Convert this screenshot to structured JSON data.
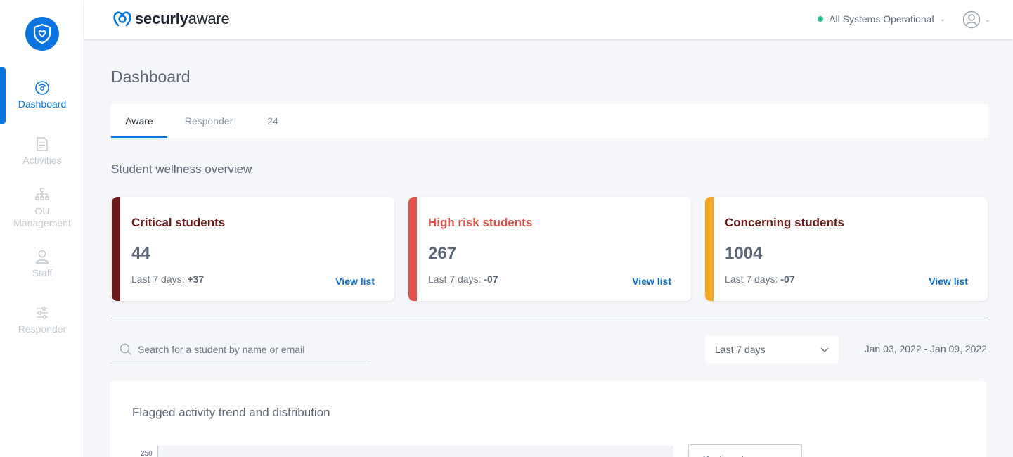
{
  "brand": {
    "name_part1": "securly",
    "name_part2": "aware"
  },
  "sidebar": {
    "items": [
      {
        "label": "Dashboard",
        "icon": "dashboard-gauge-icon",
        "active": true
      },
      {
        "label": "Activities",
        "icon": "document-icon",
        "active": false
      },
      {
        "label": "OU Management",
        "icon": "org-tree-icon",
        "active": false
      },
      {
        "label": "Staff",
        "icon": "person-icon",
        "active": false
      },
      {
        "label": "Responder",
        "icon": "sliders-icon",
        "active": false
      }
    ]
  },
  "header": {
    "status_text": "All Systems Operational",
    "status_color": "#27c08f"
  },
  "page": {
    "title": "Dashboard",
    "tabs": [
      {
        "label": "Aware",
        "active": true
      },
      {
        "label": "Responder",
        "active": false
      },
      {
        "label": "24",
        "active": false
      }
    ],
    "section_title": "Student wellness overview"
  },
  "cards": [
    {
      "title": "Critical students",
      "count": "44",
      "sub_label": "Last 7 days:",
      "sub_value": "+37",
      "link": "View list",
      "color": "#6b1a1a"
    },
    {
      "title": "High risk students",
      "count": "267",
      "sub_label": "Last 7 days:",
      "sub_value": "-07",
      "link": "View list",
      "color": "#e0524a"
    },
    {
      "title": "Concerning students",
      "count": "1004",
      "sub_label": "Last 7 days:",
      "sub_value": "-07",
      "link": "View list",
      "color": "#f5a623"
    }
  ],
  "filters": {
    "search_placeholder": "Search for a student by name or email",
    "period": "Last 7 days",
    "date_range": "Jan 03, 2022 - Jan 09, 2022"
  },
  "panel": {
    "title": "Flagged activity trend and distribution",
    "y_tick_top": "250",
    "dropdown_label": "Sentiments"
  }
}
